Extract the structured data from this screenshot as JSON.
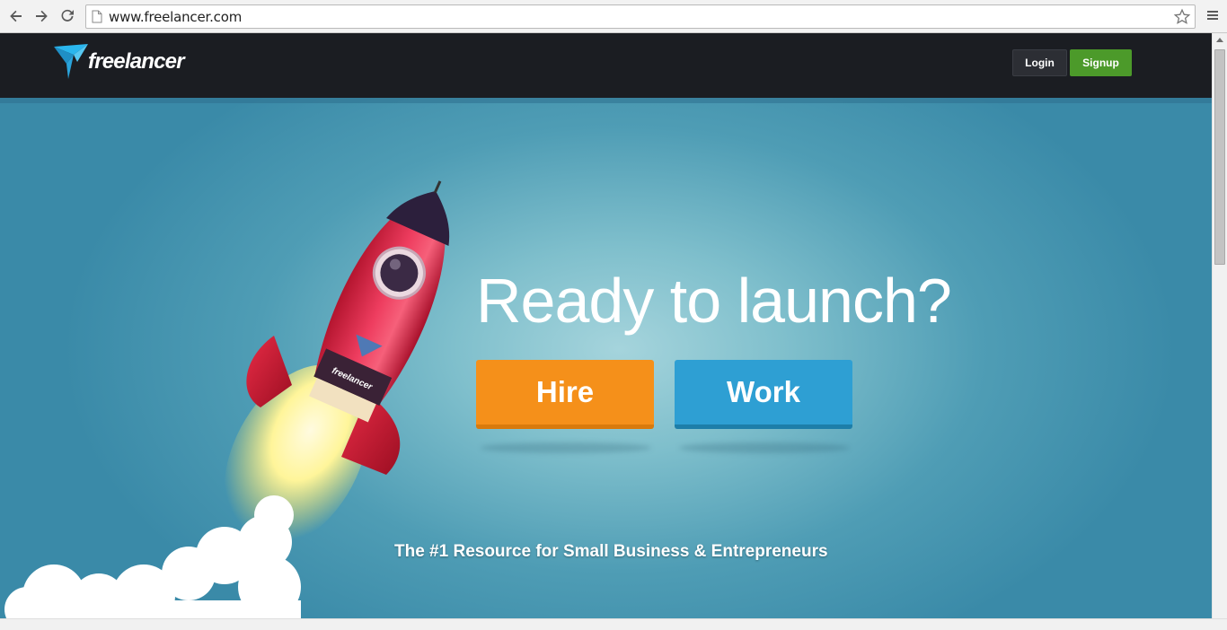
{
  "browser": {
    "url": "www.freelancer.com",
    "icons": [
      "back-icon",
      "forward-icon",
      "reload-icon",
      "page-icon",
      "star-icon",
      "menu-icon"
    ]
  },
  "header": {
    "logo_text": "freelancer",
    "login_label": "Login",
    "signup_label": "Signup",
    "signup_color": "#4c9a2a"
  },
  "hero": {
    "headline": "Ready to launch?",
    "hire_label": "Hire",
    "work_label": "Work",
    "hire_color": "#f5901a",
    "work_color": "#2e9fd3",
    "tagline": "The #1 Resource for Small Business & Entrepreneurs",
    "rocket_label": "freelancer"
  }
}
